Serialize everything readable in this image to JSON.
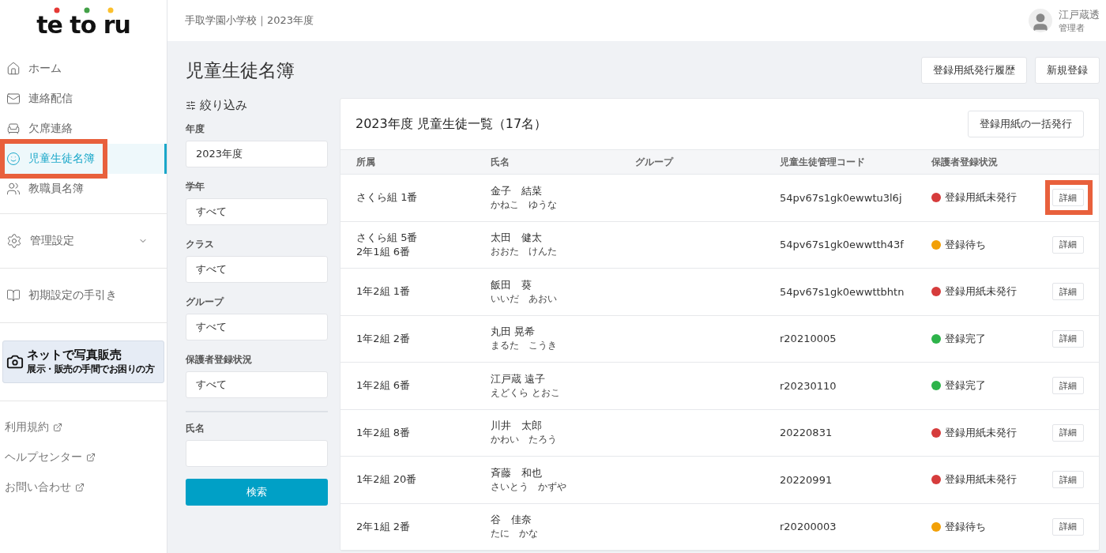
{
  "logo": {
    "text": "te to ru"
  },
  "header": {
    "school": "手取学園小学校｜2023年度",
    "user_name": "江戸蔵透",
    "user_role": "管理者"
  },
  "nav": [
    {
      "kind": "home",
      "label": "ホーム",
      "selected": false,
      "highlighted": false
    },
    {
      "kind": "mail",
      "label": "連絡配信",
      "selected": false,
      "highlighted": false
    },
    {
      "kind": "desk",
      "label": "欠席連絡",
      "selected": false,
      "highlighted": false
    },
    {
      "kind": "student",
      "label": "児童生徒名簿",
      "selected": true,
      "highlighted": true
    },
    {
      "kind": "teacher",
      "label": "教職員名簿",
      "selected": false,
      "highlighted": false
    }
  ],
  "settings": {
    "label": "管理設定",
    "expanded": false
  },
  "guide": {
    "label": "初期設定の手引き"
  },
  "banner": {
    "title": "ネットで写真販売",
    "subtitle": "展示・販売の手間でお困りの方"
  },
  "links": [
    "利用規約",
    "ヘルプセンター",
    "お問い合わせ"
  ],
  "page_title": "児童生徒名簿",
  "top_buttons": [
    "登録用紙発行履歴",
    "新規登録"
  ],
  "filter": {
    "title": "絞り込み",
    "fields": [
      {
        "label": "年度",
        "value": "2023年度"
      },
      {
        "label": "学年",
        "value": "すべて"
      },
      {
        "label": "クラス",
        "value": "すべて"
      },
      {
        "label": "グループ",
        "value": "すべて"
      },
      {
        "label": "保護者登録状況",
        "value": "すべて"
      }
    ],
    "name_label": "氏名",
    "search": "検索"
  },
  "table": {
    "title": "2023年度 児童生徒一覧（17名）",
    "bulk_button": "登録用紙の一括発行",
    "columns": [
      "所属",
      "氏名",
      "グループ",
      "児童生徒管理コード",
      "保護者登録状況"
    ],
    "rows": [
      {
        "class": [
          "さくら組 1番"
        ],
        "name": "金子　結菜",
        "kana": "かねこ　ゆうな",
        "code": "54pv67s1gk0ewwtu3l6j",
        "status": "登録用紙未発行",
        "color": "#d63c3c",
        "action": "詳細",
        "highlighted": true
      },
      {
        "class": [
          "さくら組 5番",
          "2年1組 6番"
        ],
        "name": "太田　健太",
        "kana": "おおた　けんた",
        "code": "54pv67s1gk0ewwtth43f",
        "status": "登録待ち",
        "color": "#f2a007",
        "action": "詳細",
        "highlighted": false
      },
      {
        "class": [
          "1年2組 1番"
        ],
        "name": "飯田　葵",
        "kana": "いいだ　あおい",
        "code": "54pv67s1gk0ewwttbhtn",
        "status": "登録用紙未発行",
        "color": "#d63c3c",
        "action": "詳細",
        "highlighted": false
      },
      {
        "class": [
          "1年2組 2番"
        ],
        "name": "丸田 晃希",
        "kana": "まるた　こうき",
        "code": "r20210005",
        "status": "登録完了",
        "color": "#2db34a",
        "action": "詳細",
        "highlighted": false
      },
      {
        "class": [
          "1年2組 6番"
        ],
        "name": "江戸蔵 遠子",
        "kana": "えどくら とおこ",
        "code": "r20230110",
        "status": "登録完了",
        "color": "#2db34a",
        "action": "詳細",
        "highlighted": false
      },
      {
        "class": [
          "1年2組 8番"
        ],
        "name": "川井　太郎",
        "kana": "かわい　たろう",
        "code": "20220831",
        "status": "登録用紙未発行",
        "color": "#d63c3c",
        "action": "詳細",
        "highlighted": false
      },
      {
        "class": [
          "1年2組 20番"
        ],
        "name": "斉藤　和也",
        "kana": "さいとう　かずや",
        "code": "20220991",
        "status": "登録用紙未発行",
        "color": "#d63c3c",
        "action": "詳細",
        "highlighted": false
      },
      {
        "class": [
          "2年1組 2番"
        ],
        "name": "谷　佳奈",
        "kana": "たに　かな",
        "code": "r20200003",
        "status": "登録待ち",
        "color": "#f2a007",
        "action": "詳細",
        "highlighted": false
      }
    ]
  }
}
